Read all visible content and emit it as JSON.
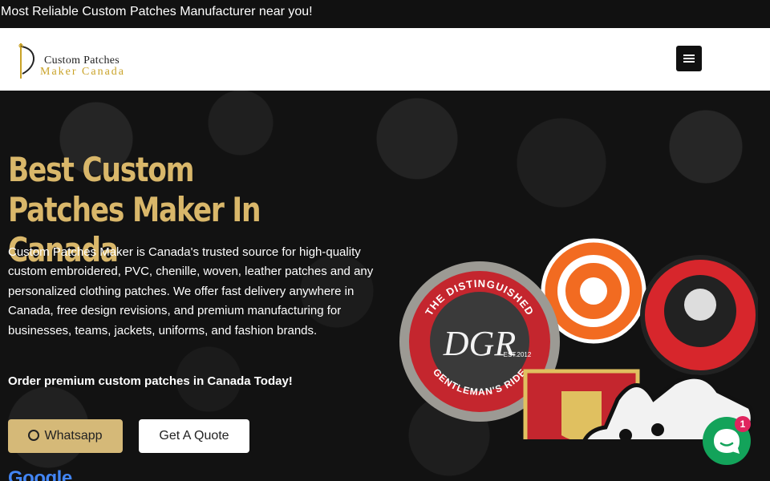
{
  "topbar": {
    "text": "Most Reliable Custom Patches Manufacturer near you!"
  },
  "header": {
    "logo_line1": "Custom Patches",
    "logo_line2": "Maker Canada",
    "menu_icon": "hamburger-icon"
  },
  "hero": {
    "title": "Best Custom Patches Maker In Canada",
    "description": "Custom Patches Maker is Canada's trusted source for high-quality custom embroidered, PVC, chenille, woven, leather patches and any personalized clothing patches. We offer fast delivery anywhere in Canada, free design revisions, and premium manufacturing for businesses, teams, jackets, uniforms, and fashion brands.",
    "cta_text": "Order premium custom patches in Canada Today!",
    "whatsapp_label": "Whatsapp",
    "quote_label": "Get A Quote",
    "google_text": "Google"
  },
  "patches_image": {
    "patch1_text_top": "THE DISTINGUISHED",
    "patch1_monogram": "DGR",
    "patch1_text_bottom": "GENTLEMAN'S RIDE",
    "patch1_year": "EST.2012"
  },
  "chat": {
    "badge_count": "1",
    "icon": "chat-bubble-icon"
  },
  "colors": {
    "accent_gold": "#d9b76a",
    "button_gold": "#d5b978",
    "chat_green": "#13a35a"
  }
}
